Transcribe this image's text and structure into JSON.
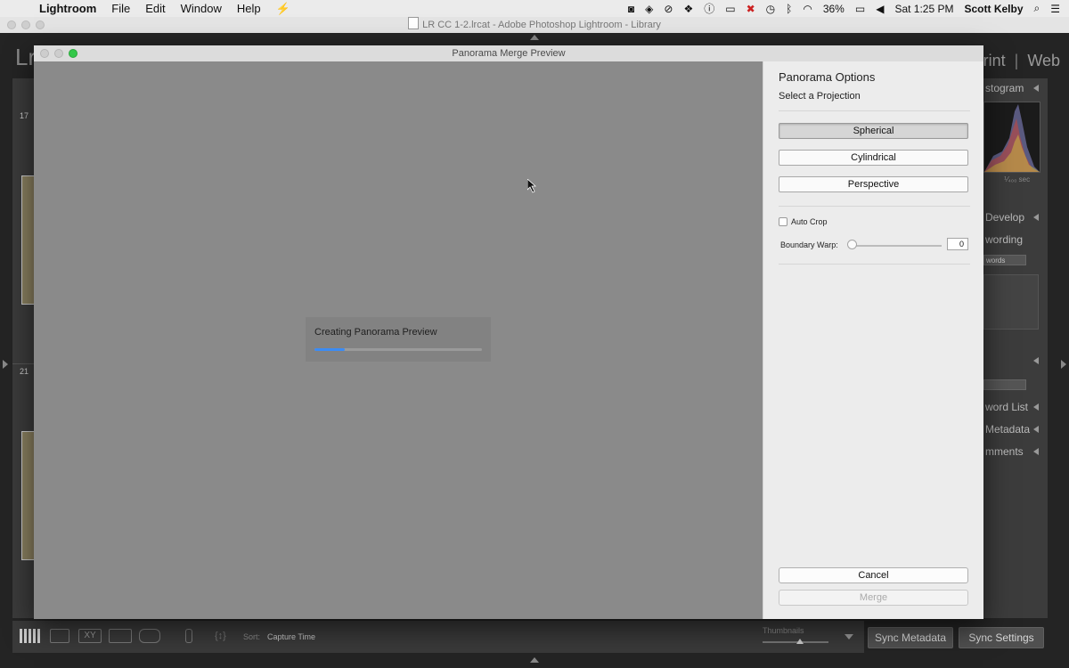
{
  "menubar": {
    "app": "Lightroom",
    "items": [
      "File",
      "Edit",
      "Window",
      "Help"
    ],
    "battery": "36%",
    "clock": "Sat 1:25 PM",
    "user": "Scott Kelby"
  },
  "window": {
    "title": "LR CC 1-2.lrcat - Adobe Photoshop Lightroom - Library"
  },
  "lightroom_bg": {
    "logo": "Lr",
    "modules_partial": "rint",
    "module_web": "Web",
    "grid_cells": [
      "17",
      "21"
    ],
    "right_panels": {
      "histogram": "stogram",
      "shutter": "⅟₄₀₀ sec",
      "develop": "Develop",
      "keywording": "wording",
      "keywords_field": "words",
      "keyword_list": "word List",
      "metadata": "Metadata",
      "comments": "mments"
    },
    "toolbar": {
      "sort_label": "Sort:",
      "sort_value": "Capture Time",
      "thumbnails_label": "Thumbnails",
      "sync_metadata": "Sync Metadata",
      "sync_settings": "Sync Settings"
    }
  },
  "dialog": {
    "title": "Panorama Merge Preview",
    "progress": {
      "label": "Creating Panorama Preview",
      "value": 0.18
    },
    "options": {
      "title": "Panorama Options",
      "projection_label": "Select a Projection",
      "projections": [
        {
          "label": "Spherical",
          "selected": true
        },
        {
          "label": "Cylindrical",
          "selected": false
        },
        {
          "label": "Perspective",
          "selected": false
        }
      ],
      "auto_crop_label": "Auto Crop",
      "auto_crop_checked": false,
      "boundary_warp_label": "Boundary Warp:",
      "boundary_warp_value": "0"
    },
    "buttons": {
      "cancel": "Cancel",
      "merge": "Merge"
    }
  },
  "colors": {
    "progress_accent": "#3b8cf5",
    "zoom_green": "#34c84a"
  }
}
